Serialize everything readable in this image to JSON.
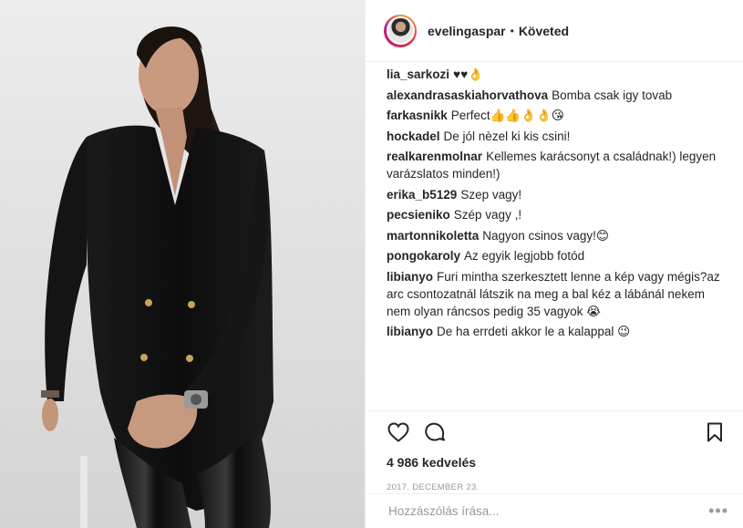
{
  "header": {
    "username": "evelingaspar",
    "separator": "•",
    "follow_status": "Követed"
  },
  "comments": [
    {
      "user": "lia_sarkozi",
      "text": "♥♥👌"
    },
    {
      "user": "alexandrasaskiahorvathova",
      "text": "Bomba csak igy tovab"
    },
    {
      "user": "farkasnikk",
      "text": "Perfect👍👍👌👌😘"
    },
    {
      "user": "hockadel",
      "text": "De jól nèzel ki kis csini!"
    },
    {
      "user": "realkarenmolnar",
      "text": "Kellemes karácsonyt a családnak!) legyen varázslatos minden!)"
    },
    {
      "user": "erika_b5129",
      "text": "Szep vagy!"
    },
    {
      "user": "pecsieniko",
      "text": "Szép vagy ,!"
    },
    {
      "user": "martonnikoletta",
      "text": "Nagyon csinos vagy!😊"
    },
    {
      "user": "pongokaroly",
      "text": "Az egyik legjobb fotód"
    },
    {
      "user": "libianyo",
      "text": "Furi mintha szerkesztett lenne a kép vagy mégis?az arc csontozatnál látszik na meg a bal kéz a lábánál nekem nem olyan ráncsos pedig 35 vagyok 😭"
    },
    {
      "user": "libianyo",
      "text": "De ha errdeti akkor le a kalappal 😉"
    }
  ],
  "actions": {
    "likes": "4 986 kedvelés",
    "date": "2017. DECEMBER 23."
  },
  "comment_box": {
    "placeholder": "Hozzászólás írása...",
    "more": "•••"
  },
  "icons": {
    "like": "heart-icon",
    "comment": "comment-icon",
    "save": "bookmark-icon",
    "more": "ellipsis-icon"
  },
  "colors": {
    "border": "#efefef",
    "muted": "#999999",
    "text": "#262626"
  }
}
